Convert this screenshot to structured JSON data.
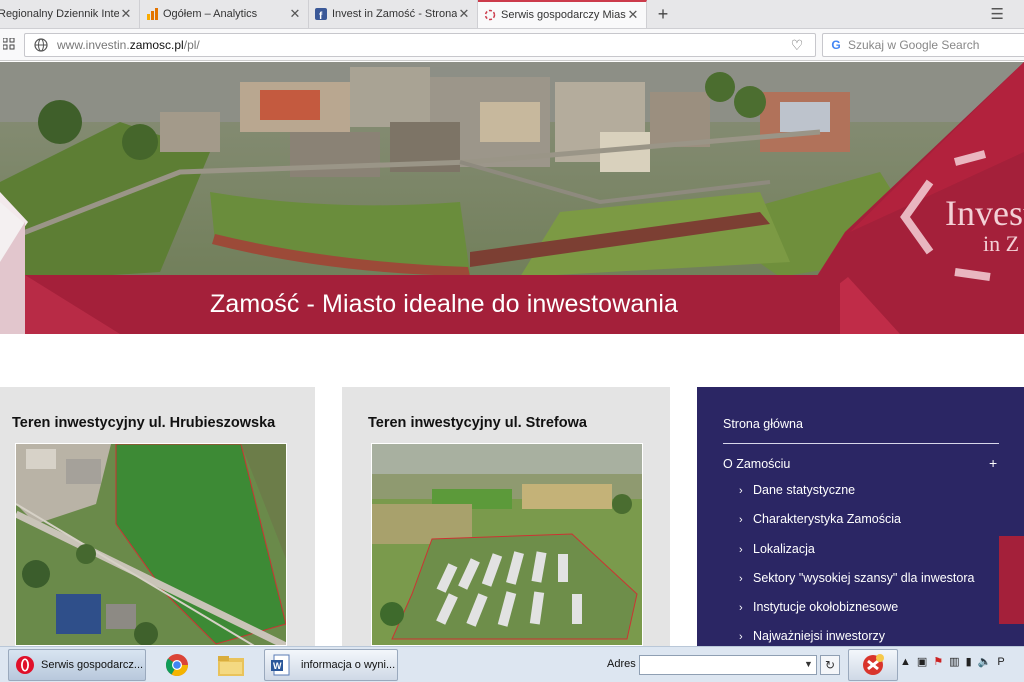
{
  "browser": {
    "tabs": [
      {
        "title": "Regionalny Dziennik Internetowy",
        "favicon": "news-icon",
        "active": false
      },
      {
        "title": "Ogółem – Analytics",
        "favicon": "analytics-icon",
        "active": false
      },
      {
        "title": "Invest in Zamość - Strona",
        "favicon": "facebook-icon",
        "active": false
      },
      {
        "title": "Serwis gospodarczy Miasta",
        "favicon": "loading-icon",
        "active": true
      }
    ],
    "new_tab_label": "+",
    "url_prefix": "www.investin.",
    "url_domain": "zamosc.pl",
    "url_path": "/pl/",
    "search_placeholder": "Szukaj w Google Search",
    "accent": "#cc3b4b"
  },
  "hero": {
    "title": "Zamość - Miasto idealne do inwestowania",
    "logo_line1": "Invest",
    "logo_line2": "in Z",
    "brand_color": "#a4203a"
  },
  "cards": [
    {
      "title": "Teren inwestycyjny ul. Hrubieszowska"
    },
    {
      "title": "Teren inwestycyjny ul. Strefowa"
    }
  ],
  "sidenav": {
    "home": "Strona główna",
    "about": "O Zamościu",
    "expand": "+",
    "items": [
      "Dane statystyczne",
      "Charakterystyka Zamościa",
      "Lokalizacja",
      "Sektory \"wysokiej szansy\" dla inwestora",
      "Instytucje okołobiznesowe",
      "Najważniejsi inwestorzy"
    ],
    "chevron": "›",
    "background": "#2b2664"
  },
  "taskbar": {
    "opera_label": "Serwis gospodarcz...",
    "word_label": "informacja o wyni...",
    "address_label": "Adres",
    "address_value": "",
    "tray_text": "P"
  }
}
